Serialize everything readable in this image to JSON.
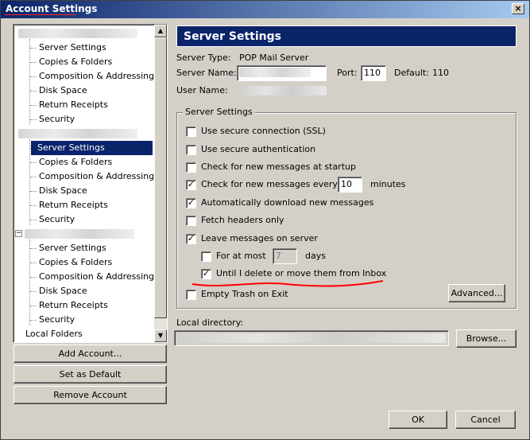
{
  "window": {
    "title": "Account Settings",
    "close_glyph": "×"
  },
  "tree": {
    "group1": [
      "Server Settings",
      "Copies & Folders",
      "Composition & Addressing",
      "Disk Space",
      "Return Receipts",
      "Security"
    ],
    "group2": [
      "Server Settings",
      "Copies & Folders",
      "Composition & Addressing",
      "Disk Space",
      "Return Receipts",
      "Security"
    ],
    "group3": [
      "Server Settings",
      "Copies & Folders",
      "Composition & Addressing",
      "Disk Space",
      "Return Receipts",
      "Security"
    ],
    "local_folders": "Local Folders",
    "selected": "group2.0",
    "expander_glyph": "−"
  },
  "scrollbar": {
    "up_glyph": "▲",
    "down_glyph": "▼"
  },
  "left_buttons": {
    "add_account": "Add Account...",
    "set_default": "Set as Default",
    "remove_account": "Remove Account"
  },
  "panel": {
    "header": "Server Settings",
    "server_type_label": "Server Type:",
    "server_type_value": "POP Mail Server",
    "server_name_label": "Server Name:",
    "port_label": "Port:",
    "port_value": "110",
    "default_label": "Default:",
    "default_value": "110",
    "user_name_label": "User Name:"
  },
  "group": {
    "title": "Server Settings",
    "options": {
      "ssl": {
        "label": "Use secure connection (SSL)",
        "checked": false
      },
      "secure_auth": {
        "label": "Use secure authentication",
        "checked": false
      },
      "check_startup": {
        "label": "Check for new messages at startup",
        "checked": false
      },
      "check_every": {
        "label": "Check for new messages every",
        "checked": true,
        "value": "10",
        "unit": "minutes"
      },
      "auto_download": {
        "label": "Automatically download new messages",
        "checked": true
      },
      "fetch_headers": {
        "label": "Fetch headers only",
        "checked": false
      },
      "leave_on_server": {
        "label": "Leave messages on server",
        "checked": true
      },
      "for_at_most": {
        "label": "For at most",
        "checked": false,
        "value": "7",
        "unit": "days"
      },
      "until_delete": {
        "label": "Until I delete or move them from Inbox",
        "checked": true
      }
    },
    "advanced_button": "Advanced..."
  },
  "empty_trash": {
    "label": "Empty Trash on Exit",
    "checked": false
  },
  "local_directory": {
    "label": "Local directory:",
    "browse_button": "Browse..."
  },
  "footer": {
    "ok": "OK",
    "cancel": "Cancel"
  },
  "check_glyph": "✓",
  "colors": {
    "selection": "#0a246a",
    "annotation": "#ff0000"
  }
}
